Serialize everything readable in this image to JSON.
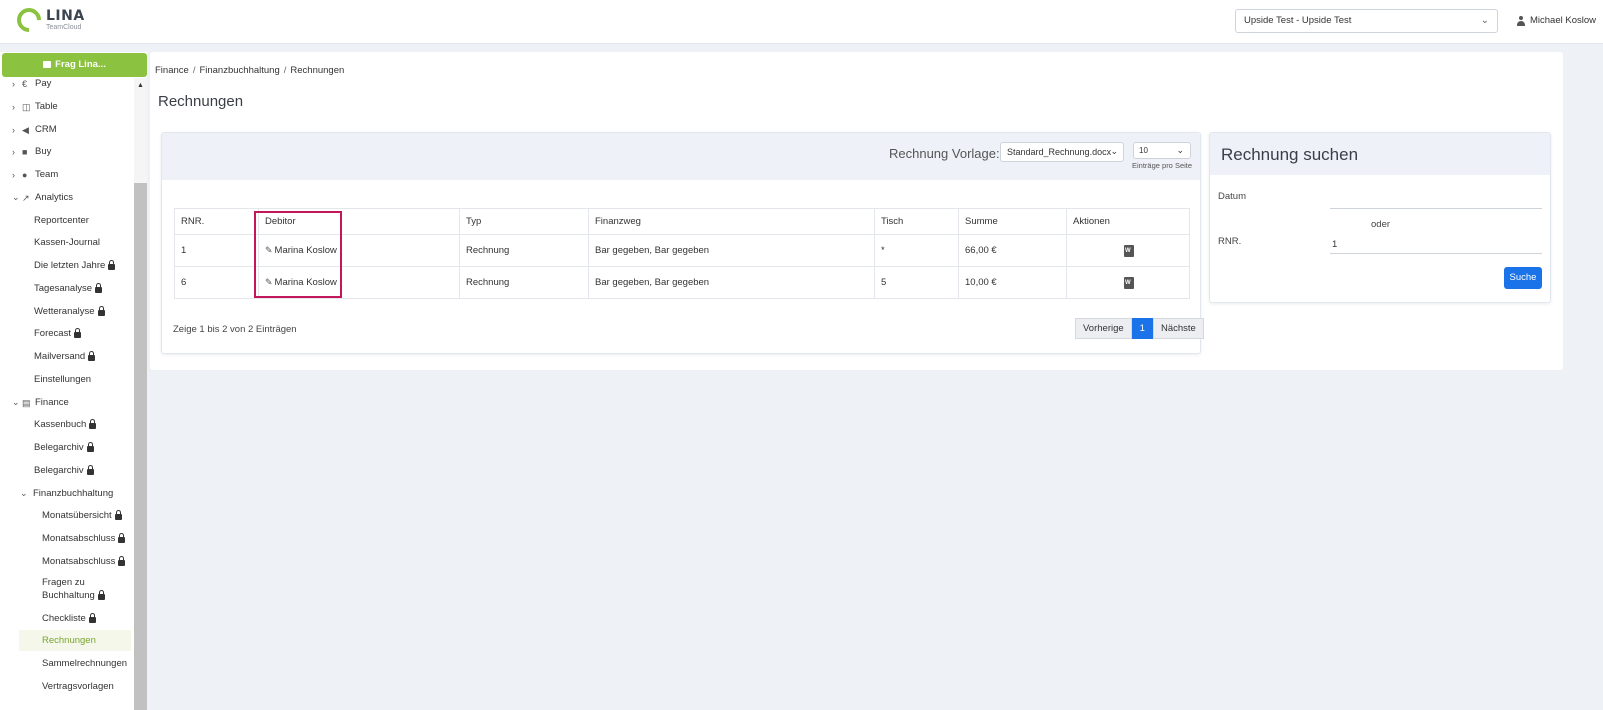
{
  "header": {
    "logo_name": "LINA",
    "logo_sub": "TeamCloud",
    "company_select": "Upside Test - Upside Test",
    "user_name": "Michael Koslow"
  },
  "sidebar": {
    "frag_button": "Frag Lina...",
    "items": [
      {
        "label": "Pay",
        "icon": "euro-icon"
      },
      {
        "label": "Table",
        "icon": "book-icon"
      },
      {
        "label": "CRM",
        "icon": "megaphone-icon"
      },
      {
        "label": "Buy",
        "icon": "truck-icon"
      },
      {
        "label": "Team",
        "icon": "users-icon"
      },
      {
        "label": "Analytics",
        "icon": "chart-icon"
      },
      {
        "label": "Reportcenter"
      },
      {
        "label": "Kassen-Journal"
      },
      {
        "label": "Die letzten Jahre"
      },
      {
        "label": "Tagesanalyse"
      },
      {
        "label": "Wetteranalyse"
      },
      {
        "label": "Forecast"
      },
      {
        "label": "Mailversand"
      },
      {
        "label": "Einstellungen"
      },
      {
        "label": "Finance",
        "icon": "calculator-icon"
      },
      {
        "label": "Kassenbuch"
      },
      {
        "label": "Belegarchiv"
      },
      {
        "label": "Belegarchiv"
      },
      {
        "label": "Finanzbuchhaltung"
      },
      {
        "label": "Monatsübersicht"
      },
      {
        "label": "Monatsabschluss"
      },
      {
        "label": "Monatsabschluss"
      },
      {
        "label": "Fragen zu"
      },
      {
        "label": "Buchhaltung"
      },
      {
        "label": "Checkliste"
      },
      {
        "label": "Rechnungen"
      },
      {
        "label": "Sammelrechnungen"
      },
      {
        "label": "Vertragsvorlagen"
      }
    ]
  },
  "breadcrumb": [
    "Finance",
    "Finanzbuchhaltung",
    "Rechnungen"
  ],
  "page_title": "Rechnungen",
  "invoices": {
    "vorlage_label": "Rechnung Vorlage:",
    "vorlage_value": "Standard_Rechnung.docx",
    "entries_value": "10",
    "entries_label": "Einträge pro Seite",
    "columns": [
      "RNR.",
      "Debitor",
      "Typ",
      "Finanzweg",
      "Tisch",
      "Summe",
      "Aktionen"
    ],
    "rows": [
      {
        "rnr": "1",
        "debitor": "Marina Koslow",
        "typ": "Rechnung",
        "finanzweg": "Bar gegeben, Bar gegeben",
        "tisch": "*",
        "summe": "66,00 €"
      },
      {
        "rnr": "6",
        "debitor": "Marina Koslow",
        "typ": "Rechnung",
        "finanzweg": "Bar gegeben, Bar gegeben",
        "tisch": "5",
        "summe": "10,00 €"
      }
    ],
    "info": "Zeige 1 bis 2 von 2 Einträgen",
    "pager": {
      "prev": "Vorherige",
      "current": "1",
      "next": "Nächste"
    }
  },
  "search": {
    "title": "Rechnung suchen",
    "datum_label": "Datum",
    "datum_value": "",
    "oder": "oder",
    "rnr_label": "RNR.",
    "rnr_value": "1",
    "button": "Suche"
  },
  "colors": {
    "brand_green": "#8bc23f",
    "primary_blue": "#1a73e8",
    "highlight": "#c2185b"
  }
}
